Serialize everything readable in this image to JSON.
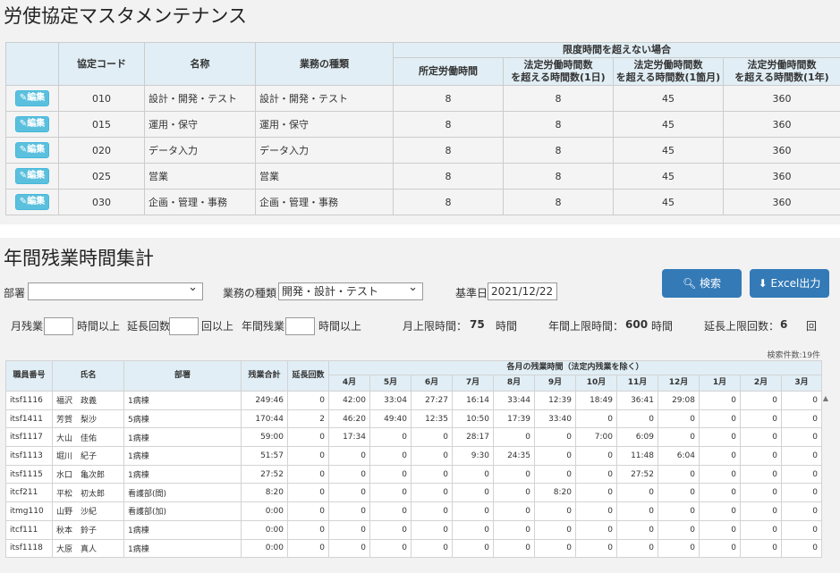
{
  "page": {
    "title": "労使協定マスタメンテナンス",
    "section2_title": "年間残業時間集計"
  },
  "agreement_table": {
    "headers": {
      "code": "協定コード",
      "name": "名称",
      "business_type": "業務の種類",
      "group": "限度時間を超えない場合",
      "h1": "所定労働時間",
      "h2a": "法定労働時間数",
      "h2b": "を超える時間数(1日)",
      "h3a": "法定労働時間数",
      "h3b": "を超える時間数(1箇月)",
      "h4a": "法定労働時間数",
      "h4b": "を超える時間数(1年)"
    },
    "edit_label": "編集",
    "rows": [
      {
        "code": "010",
        "name": "設計・開発・テスト",
        "business": "設計・開発・テスト",
        "scheduled": "8",
        "day": "8",
        "month": "45",
        "year": "360"
      },
      {
        "code": "015",
        "name": "運用・保守",
        "business": "運用・保守",
        "scheduled": "8",
        "day": "8",
        "month": "45",
        "year": "360"
      },
      {
        "code": "020",
        "name": "データ入力",
        "business": "データ入力",
        "scheduled": "8",
        "day": "8",
        "month": "45",
        "year": "360"
      },
      {
        "code": "025",
        "name": "営業",
        "business": "営業",
        "scheduled": "8",
        "day": "8",
        "month": "45",
        "year": "360"
      },
      {
        "code": "030",
        "name": "企画・管理・事務",
        "business": "企画・管理・事務",
        "scheduled": "8",
        "day": "8",
        "month": "45",
        "year": "360"
      }
    ]
  },
  "filters": {
    "dept_label": "部署",
    "dept_value": "",
    "business_label": "業務の種類",
    "business_value": "開発・設計・テスト",
    "base_date_label": "基準日",
    "base_date_value": "2021/12/22",
    "search_label": "検索",
    "excel_label": "Excel出力",
    "monthly_label": "月残業",
    "monthly_value": "",
    "monthly_suffix": "時間以上",
    "ext_label": "延長回数",
    "ext_value": "",
    "ext_suffix": "回以上",
    "annual_label": "年間残業",
    "annual_value": "",
    "annual_suffix": "時間以上",
    "month_limit_label": "月上限時間：",
    "month_limit_value": "75",
    "month_limit_unit": "時間",
    "year_limit_label": "年間上限時間：",
    "year_limit_value": "600",
    "year_limit_unit": "時間",
    "ext_limit_label": "延長上限回数：",
    "ext_limit_value": "6",
    "ext_limit_unit": "回",
    "result_count": "検索件数:19件"
  },
  "overtime_table": {
    "headers": {
      "emp_no": "職員番号",
      "name": "氏名",
      "dept": "部署",
      "total": "残業合計",
      "ext_count": "延長回数",
      "monthly_group": "各月の残業時間（法定内残業を除く）"
    },
    "months": [
      "4月",
      "5月",
      "6月",
      "7月",
      "8月",
      "9月",
      "10月",
      "11月",
      "12月",
      "1月",
      "2月",
      "3月"
    ],
    "rows": [
      {
        "id": "itsf1116",
        "name": "福沢　政義",
        "dept": "1病棟",
        "total": "249:46",
        "ext": "0",
        "m": [
          "42:00",
          "33:04",
          "27:27",
          "16:14",
          "33:44",
          "12:39",
          "18:49",
          "36:41",
          "29:08",
          "0",
          "0",
          "0"
        ]
      },
      {
        "id": "itsf1411",
        "name": "芳賀　梨沙",
        "dept": "5病棟",
        "total": "170:44",
        "ext": "2",
        "m": [
          "46:20",
          "49:40",
          "12:35",
          "10:50",
          "17:39",
          "33:40",
          "0",
          "0",
          "0",
          "0",
          "0",
          "0"
        ]
      },
      {
        "id": "itsf1117",
        "name": "大山　佳佑",
        "dept": "1病棟",
        "total": "59:00",
        "ext": "0",
        "m": [
          "17:34",
          "0",
          "0",
          "28:17",
          "0",
          "0",
          "7:00",
          "6:09",
          "0",
          "0",
          "0",
          "0"
        ]
      },
      {
        "id": "itsf1113",
        "name": "堀川　紀子",
        "dept": "1病棟",
        "total": "51:57",
        "ext": "0",
        "m": [
          "0",
          "0",
          "0",
          "9:30",
          "24:35",
          "0",
          "0",
          "11:48",
          "6:04",
          "0",
          "0",
          "0"
        ]
      },
      {
        "id": "itsf1115",
        "name": "水口　亀次郎",
        "dept": "1病棟",
        "total": "27:52",
        "ext": "0",
        "m": [
          "0",
          "0",
          "0",
          "0",
          "0",
          "0",
          "0",
          "27:52",
          "0",
          "0",
          "0",
          "0"
        ]
      },
      {
        "id": "itcf211",
        "name": "平松　初太郎",
        "dept": "看護部(間)",
        "total": "8:20",
        "ext": "0",
        "m": [
          "0",
          "0",
          "0",
          "0",
          "0",
          "8:20",
          "0",
          "0",
          "0",
          "0",
          "0",
          "0"
        ]
      },
      {
        "id": "itmg110",
        "name": "山野　沙紀",
        "dept": "看護部(加)",
        "total": "0:00",
        "ext": "0",
        "m": [
          "0",
          "0",
          "0",
          "0",
          "0",
          "0",
          "0",
          "0",
          "0",
          "0",
          "0",
          "0"
        ]
      },
      {
        "id": "itcf111",
        "name": "秋本　鈴子",
        "dept": "1病棟",
        "total": "0:00",
        "ext": "0",
        "m": [
          "0",
          "0",
          "0",
          "0",
          "0",
          "0",
          "0",
          "0",
          "0",
          "0",
          "0",
          "0"
        ]
      },
      {
        "id": "itsf1118",
        "name": "大原　真人",
        "dept": "1病棟",
        "total": "0:00",
        "ext": "0",
        "m": [
          "0",
          "0",
          "0",
          "0",
          "0",
          "0",
          "0",
          "0",
          "0",
          "0",
          "0",
          "0"
        ]
      }
    ]
  }
}
